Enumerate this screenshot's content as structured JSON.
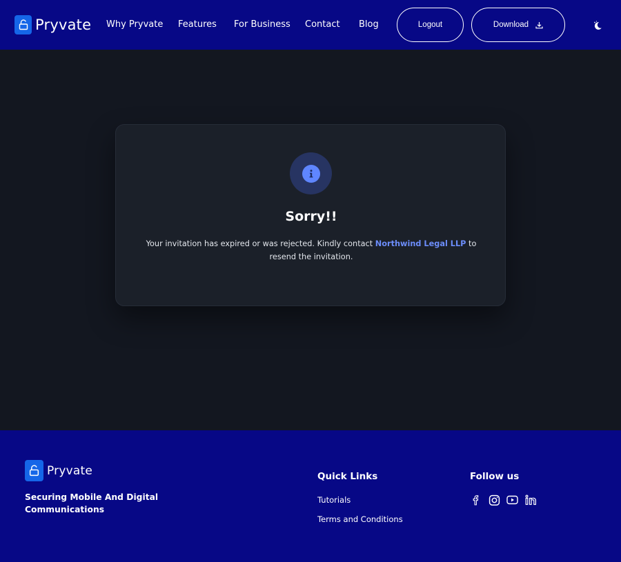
{
  "header": {
    "brand": "Pryvate",
    "nav": [
      {
        "label": "Why Pryvate"
      },
      {
        "label": "Features"
      },
      {
        "label": "For Business"
      },
      {
        "label": "Contact"
      },
      {
        "label": "Blog"
      }
    ],
    "logout_label": "Logout",
    "download_label": "Download",
    "theme_icon": "moon-icon"
  },
  "card": {
    "icon": "info-icon",
    "title": "Sorry!!",
    "message_before": "Your invitation has expired or was rejected. Kindly contact ",
    "company": "Northwind Legal LLP",
    "message_after": " to resend the invitation."
  },
  "footer": {
    "brand": "Pryvate",
    "tagline": "Securing Mobile And Digital Communications",
    "quick_links_title": "Quick Links",
    "quick_links": [
      {
        "label": "Tutorials"
      },
      {
        "label": "Terms and Conditions"
      }
    ],
    "follow_title": "Follow us",
    "social_icons": [
      "facebook-icon",
      "instagram-icon",
      "youtube-icon",
      "linkedin-icon"
    ]
  },
  "colors": {
    "header_bg": "#070886",
    "page_bg": "#131720",
    "card_bg": "#1b2029",
    "accent": "#5f86ff",
    "link": "#6c8dfa",
    "logo": "#1566e8"
  }
}
